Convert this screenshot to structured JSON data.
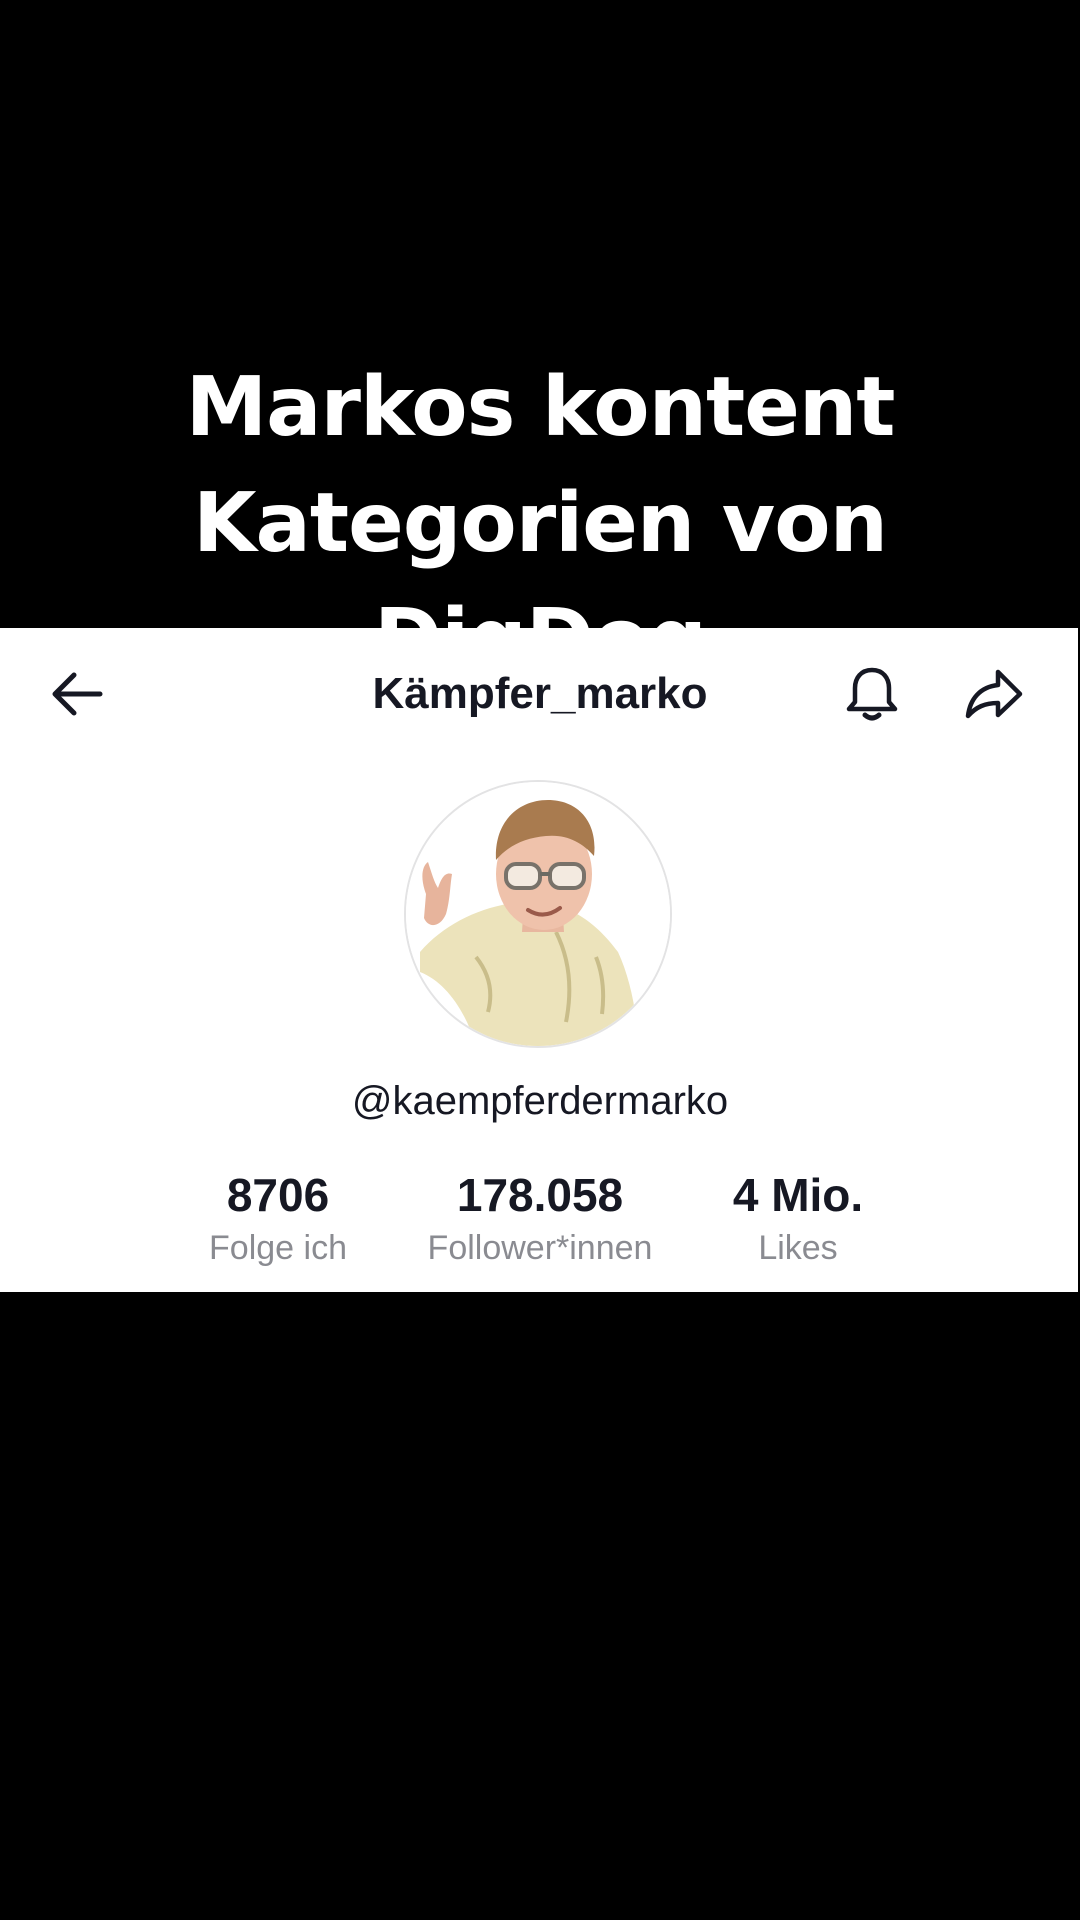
{
  "caption": {
    "lines": [
      "Markos kontent",
      "Kategorien von",
      "DigDog"
    ]
  },
  "header": {
    "title": "Kämpfer_marko",
    "back_icon": "arrow-left-icon",
    "bell_icon": "bell-icon",
    "share_icon": "share-arrow-icon"
  },
  "profile": {
    "username": "@kaempferdermarko",
    "avatar_icon": "profile-photo"
  },
  "stats": {
    "following": {
      "value": "8706",
      "label": "Folge ich"
    },
    "followers": {
      "value": "178.058",
      "label": "Follower*innen"
    },
    "likes": {
      "value": "4 Mio.",
      "label": "Likes"
    }
  },
  "colors": {
    "background": "#000000",
    "card": "#ffffff",
    "primary_text": "#161823",
    "secondary_text": "#8a8b91"
  }
}
